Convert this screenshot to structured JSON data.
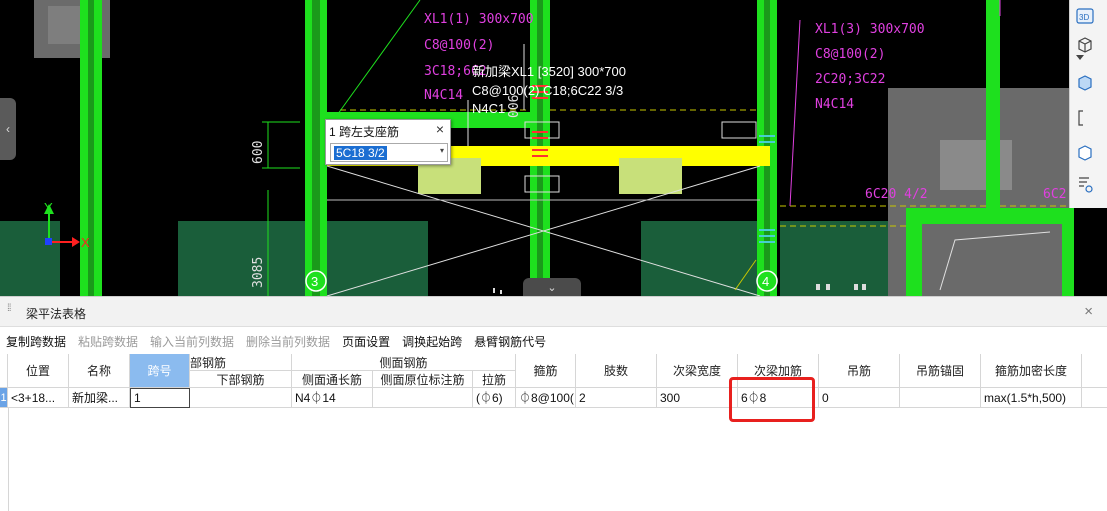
{
  "viewport": {
    "beam_labels": {
      "xl1_1": [
        "XL1(1) 300x700",
        "C8@100(2)",
        "3C18;6C2",
        "N4C14"
      ],
      "xl1_3": [
        "XL1(3) 300x700",
        "C8@100(2)",
        "2C20;3C22",
        "N4C14"
      ],
      "new_beam": [
        "新加梁XL1 [3520] 300*700",
        "C8@100(2) C18;6C22 3/3",
        "N4C1"
      ],
      "right_support": "6C20 4/2",
      "right_edge": "6C2"
    },
    "dimensions": {
      "d600": "600",
      "d3085": "3085",
      "d006": "006"
    },
    "axis_markers": {
      "left": "3",
      "right": "4"
    },
    "axes": {
      "x": "X",
      "y": "Y"
    },
    "left_handle_icon": "‹",
    "bottom_handle_icon": "⌄"
  },
  "popup": {
    "title": "1 跨左支座筋",
    "close_icon": "×",
    "value": "5C18 3/2",
    "dropdown_icon": "▾"
  },
  "right_toolbar": {
    "top_icon_label": "3D",
    "icons": [
      "view-3d-icon",
      "cube-icon",
      "chevron-down-icon",
      "cube-selected-icon",
      "bracket-icon",
      "cube-outline-icon",
      "list-eye-icon"
    ]
  },
  "panel": {
    "title": "梁平法表格",
    "close_icon": "×",
    "toolbar": [
      {
        "label": "复制跨数据",
        "enabled": true
      },
      {
        "label": "粘贴跨数据",
        "enabled": false
      },
      {
        "label": "输入当前列数据",
        "enabled": false
      },
      {
        "label": "删除当前列数据",
        "enabled": false
      },
      {
        "label": "页面设置",
        "enabled": true
      },
      {
        "label": "调换起始跨",
        "enabled": true
      },
      {
        "label": "悬臂钢筋代号",
        "enabled": true
      }
    ],
    "table": {
      "headers": {
        "position": "位置",
        "name": "名称",
        "span_no": "跨号",
        "bottom_group": "部钢筋",
        "bottom_rebar": "下部钢筋",
        "side_group": "侧面钢筋",
        "side_through": "侧面通长筋",
        "side_in_situ": "侧面原位标注筋",
        "tie": "拉筋",
        "stirrup": "箍筋",
        "legs": "肢数",
        "secondary_width": "次梁宽度",
        "secondary_add": "次梁加筋",
        "hanger": "吊筋",
        "hanger_anchor": "吊筋锚固",
        "dense_length": "箍筋加密长度"
      },
      "row": {
        "index": "1",
        "position": "<3+18...",
        "name": "新加梁...",
        "span_no": "1",
        "bottom_rebar": "",
        "side_through": "N4⏀14",
        "side_in_situ": "",
        "tie": "(⏀6)",
        "stirrup": "⏀8@100(",
        "legs": "2",
        "secondary_width": "300",
        "secondary_add": "6⏀8",
        "hanger": "0",
        "hanger_anchor": "",
        "dense_length": "max(1.5*h,500)"
      }
    }
  },
  "colors": {
    "cad_background": "#000000",
    "column_green": "#1ee01e",
    "beam_yellow": "#ffff00",
    "label_magenta": "#e040e0",
    "wall_dark_green": "#1a5e3a",
    "highlight_red": "#e8201e",
    "active_header_blue": "#8bbbef"
  }
}
